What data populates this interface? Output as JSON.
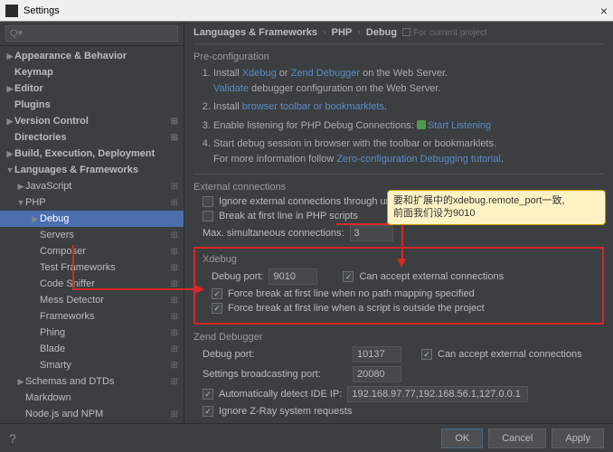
{
  "titlebar": {
    "title": "Settings",
    "close": "×"
  },
  "search": {
    "placeholder": "Q▾"
  },
  "sidebar": {
    "items": [
      {
        "label": "Appearance & Behavior",
        "arrow": "▶",
        "bold": true
      },
      {
        "label": "Keymap",
        "arrow": "",
        "bold": true
      },
      {
        "label": "Editor",
        "arrow": "▶",
        "bold": true
      },
      {
        "label": "Plugins",
        "arrow": "",
        "bold": true
      },
      {
        "label": "Version Control",
        "arrow": "▶",
        "bold": true,
        "badge": "⊞"
      },
      {
        "label": "Directories",
        "arrow": "",
        "bold": true,
        "badge": "⊞"
      },
      {
        "label": "Build, Execution, Deployment",
        "arrow": "▶",
        "bold": true
      },
      {
        "label": "Languages & Frameworks",
        "arrow": "▼",
        "bold": true
      },
      {
        "label": "JavaScript",
        "arrow": "▶",
        "indent": 1,
        "badge": "⊞"
      },
      {
        "label": "PHP",
        "arrow": "▼",
        "indent": 1,
        "badge": "⊞"
      },
      {
        "label": "Debug",
        "arrow": "▶",
        "indent": 2,
        "selected": true
      },
      {
        "label": "Servers",
        "arrow": "",
        "indent": 2,
        "badge": "⊞"
      },
      {
        "label": "Composer",
        "arrow": "",
        "indent": 2,
        "badge": "⊞"
      },
      {
        "label": "Test Frameworks",
        "arrow": "",
        "indent": 2,
        "badge": "⊞"
      },
      {
        "label": "Code Sniffer",
        "arrow": "",
        "indent": 2,
        "badge": "⊞"
      },
      {
        "label": "Mess Detector",
        "arrow": "",
        "indent": 2,
        "badge": "⊞"
      },
      {
        "label": "Frameworks",
        "arrow": "",
        "indent": 2,
        "badge": "⊞"
      },
      {
        "label": "Phing",
        "arrow": "",
        "indent": 2,
        "badge": "⊞"
      },
      {
        "label": "Blade",
        "arrow": "",
        "indent": 2,
        "badge": "⊞"
      },
      {
        "label": "Smarty",
        "arrow": "",
        "indent": 2,
        "badge": "⊞"
      },
      {
        "label": "Schemas and DTDs",
        "arrow": "▶",
        "indent": 1,
        "badge": "⊞"
      },
      {
        "label": "Markdown",
        "arrow": "",
        "indent": 1
      },
      {
        "label": "Node.js and NPM",
        "arrow": "",
        "indent": 1,
        "badge": "⊞"
      }
    ]
  },
  "breadcrumb": {
    "l1": "Languages & Frameworks",
    "l2": "PHP",
    "l3": "Debug",
    "project": "For current project"
  },
  "preconfig": {
    "title": "Pre-configuration",
    "step1a": "Install ",
    "step1_xdebug": "Xdebug",
    "step1_or": " or ",
    "step1_zend": "Zend Debugger",
    "step1b": " on the Web Server.",
    "step1c": "Validate",
    "step1d": " debugger configuration on the Web Server.",
    "step2a": "Install ",
    "step2_link": "browser toolbar or bookmarklets",
    "step2b": ".",
    "step3a": "Enable listening for PHP Debug Connections: ",
    "step3_link": "Start Listening",
    "step4a": "Start debug session in browser with the toolbar or bookmarklets.",
    "step4b": "For more information follow ",
    "step4_link": "Zero-configuration Debugging tutorial",
    "step4c": "."
  },
  "external": {
    "title": "External connections",
    "ignore": "Ignore external connections through unregistered server configurations",
    "break_first": "Break at first line in PHP scripts",
    "max_label": "Max. simultaneous connections:",
    "max_value": "3"
  },
  "xdebug": {
    "title": "Xdebug",
    "port_label": "Debug port:",
    "port_value": "9010",
    "can_accept": "Can accept external connections",
    "force_nopath": "Force break at first line when no path mapping specified",
    "force_outside": "Force break at first line when a script is outside the project"
  },
  "zend": {
    "title": "Zend Debugger",
    "port_label": "Debug port:",
    "port_value": "10137",
    "can_accept": "Can accept external connections",
    "broadcast_label": "Settings broadcasting port:",
    "broadcast_value": "20080",
    "auto_ip_label": "Automatically detect IDE IP:",
    "auto_ip_value": "192.168.97.77,192.168.56.1,127.0.0.1",
    "ignore_zray": "Ignore Z-Ray system requests"
  },
  "callout": {
    "line1": "要和扩展中的xdebug.remote_port一致,",
    "line2": "前面我们设为9010"
  },
  "footer": {
    "help": "?",
    "ok": "OK",
    "cancel": "Cancel",
    "apply": "Apply"
  }
}
